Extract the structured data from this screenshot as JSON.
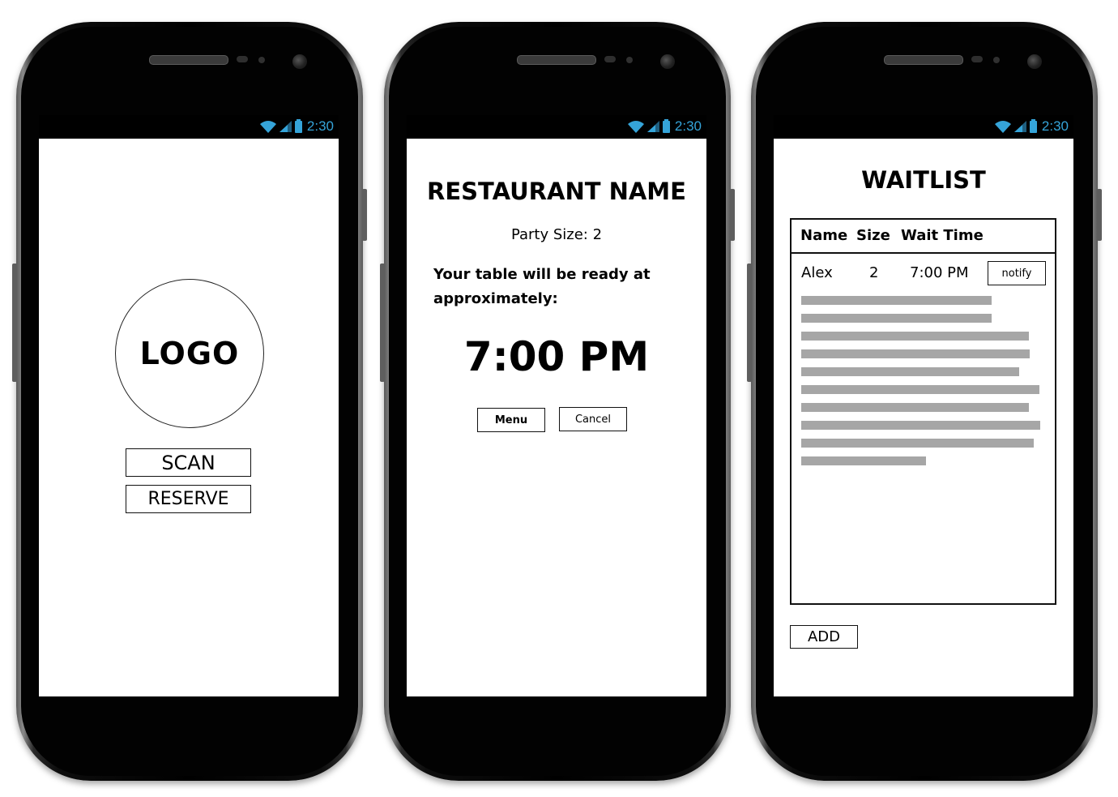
{
  "status_bar": {
    "time": "2:30"
  },
  "screens": {
    "home": {
      "logo_text": "LOGO",
      "scan_label": "SCAN",
      "reserve_label": "RESERVE"
    },
    "reservation": {
      "restaurant_name": "RESTAURANT NAME",
      "party_size": "Party Size: 2",
      "ready_message_line1": "Your table will be ready at",
      "ready_message_line2": "approximately:",
      "ready_time": "7:00 PM",
      "menu_label": "Menu",
      "cancel_label": "Cancel"
    },
    "waitlist": {
      "title": "WAITLIST",
      "columns": [
        "Name",
        "Size",
        "Wait Time"
      ],
      "rows": [
        {
          "name": "Alex",
          "size": "2",
          "wait_time": "7:00 PM",
          "action_label": "notify"
        }
      ],
      "add_label": "ADD"
    }
  },
  "colors": {
    "status_accent": "#35a4d9",
    "placeholder_text_bar": "#a6a6a6"
  }
}
